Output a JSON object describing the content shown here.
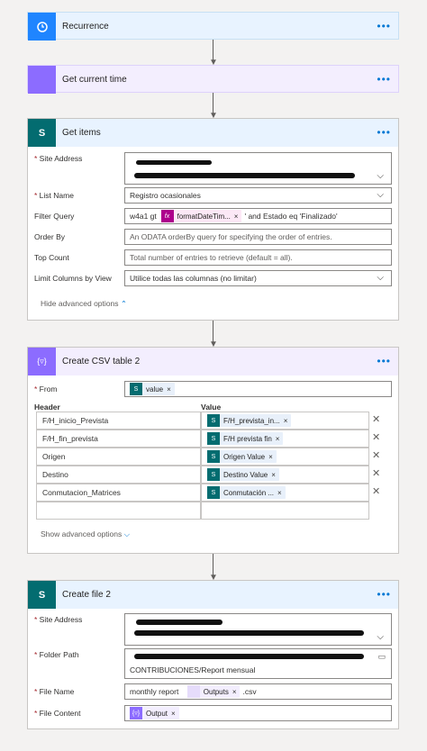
{
  "recurrence": {
    "title": "Recurrence"
  },
  "current_time": {
    "title": "Get current time"
  },
  "get_items": {
    "title": "Get items",
    "site_address_label": "Site Address",
    "list_name_label": "List Name",
    "list_name_value": "Registro ocasionales",
    "filter_label": "Filter Query",
    "filter_prefix": "w4a1 gt",
    "filter_token": "formatDateTim...",
    "filter_suffix": "' and Estado eq 'Finalizado'",
    "order_label": "Order By",
    "order_placeholder": "An ODATA orderBy query for specifying the order of entries.",
    "top_label": "Top Count",
    "top_placeholder": "Total number of entries to retrieve (default = all).",
    "limit_label": "Limit Columns by View",
    "limit_value": "Utilice todas las columnas (no limitar)",
    "hide_advanced": "Hide advanced options"
  },
  "csv": {
    "title": "Create CSV table 2",
    "from_label": "From",
    "from_token": "value",
    "header_col": "Header",
    "value_col": "Value",
    "rows": [
      {
        "header": "F/H_inicio_Prevista",
        "value": "F/H_prevista_in..."
      },
      {
        "header": "F/H_fin_prevista",
        "value": "F/H prevista fin"
      },
      {
        "header": "Origen",
        "value": "Origen Value"
      },
      {
        "header": "Destino",
        "value": "Destino Value"
      },
      {
        "header": "Conmutacion_Matrices",
        "value": "Conmutación ..."
      }
    ],
    "show_advanced": "Show advanced options"
  },
  "create_file": {
    "title": "Create file 2",
    "site_address_label": "Site Address",
    "folder_label": "Folder Path",
    "folder_value": "CONTRIBUCIONES/Report mensual",
    "file_name_label": "File Name",
    "file_name_prefix": "monthly report",
    "file_name_token": "Outputs",
    "file_name_suffix": ".csv",
    "file_content_label": "File Content",
    "file_content_token": "Output"
  },
  "colors": {
    "recurrence": "#1f85ff",
    "variable": "#8c6cff",
    "sharepoint": "#036c70",
    "data_ops": "#8c6cff",
    "expr": "#ad008c"
  }
}
